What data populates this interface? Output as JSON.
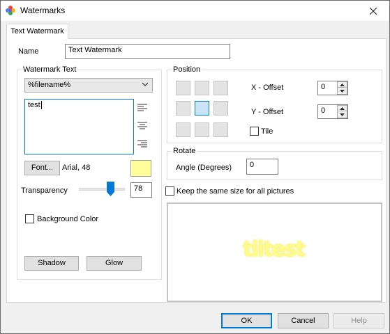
{
  "window": {
    "title": "Watermarks"
  },
  "tabs": [
    {
      "label": "Text Watermark"
    }
  ],
  "name_row": {
    "label": "Name",
    "value": "Text Watermark"
  },
  "watermark_text": {
    "group_title": "Watermark Text",
    "dropdown_value": "%filename%",
    "text_value": "test",
    "font_button": "Font...",
    "font_desc": "Arial, 48",
    "color": "#ffff99"
  },
  "transparency": {
    "label": "Transparency",
    "value": "78",
    "level_fraction": 0.78
  },
  "background_color": {
    "label": "Background Color",
    "checked": false
  },
  "effects": {
    "shadow": "Shadow",
    "glow": "Glow"
  },
  "position": {
    "group_title": "Position",
    "selected": "middle-center",
    "x_offset_label": "X - Offset",
    "x_offset_value": "0",
    "y_offset_label": "Y - Offset",
    "y_offset_value": "0",
    "tile_label": "Tile",
    "tile_checked": false
  },
  "rotate": {
    "group_title": "Rotate",
    "angle_label": "Angle (Degrees)",
    "angle_value": "0"
  },
  "keep_size": {
    "label": "Keep the same size for all pictures",
    "checked": false
  },
  "preview": {
    "text": "tiitest",
    "color": "#fffa8a"
  },
  "footer": {
    "ok": "OK",
    "cancel": "Cancel",
    "help": "Help"
  },
  "icons": {
    "app": "watermark-app-icon",
    "close": "close-icon",
    "dropdown": "chevron-down-icon"
  }
}
